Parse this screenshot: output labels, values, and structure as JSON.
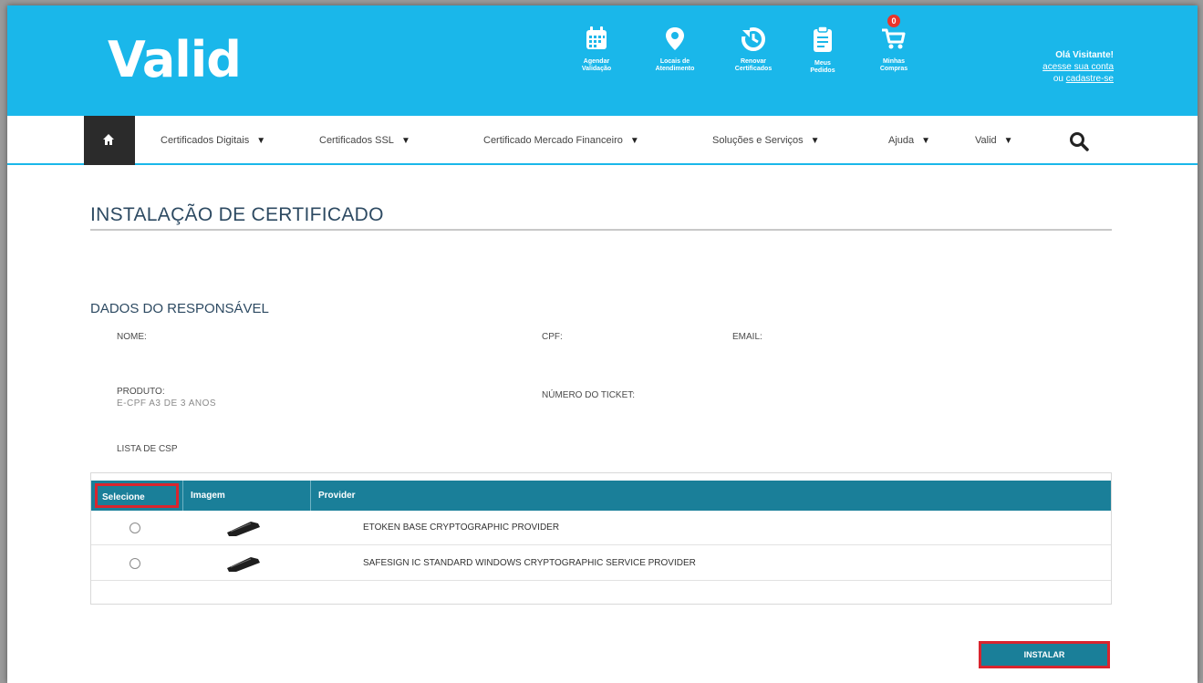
{
  "header": {
    "logo": "Valid",
    "icons": [
      {
        "label1": "Agendar",
        "label2": "Validação",
        "icon": "calendar-icon"
      },
      {
        "label1": "Locais de",
        "label2": "Atendimento",
        "icon": "location-pin-icon"
      },
      {
        "label1": "Renovar",
        "label2": "Certificados",
        "icon": "renew-clock-icon"
      },
      {
        "label1": "Meus",
        "label2": "Pedidos",
        "icon": "clipboard-icon"
      },
      {
        "label1": "Minhas",
        "label2": "Compras",
        "icon": "cart-icon"
      }
    ],
    "cart_count": "0",
    "greeting": "Olá Visitante!",
    "login_link": "acesse sua conta",
    "or_text": "ou",
    "register_link": "cadastre-se"
  },
  "nav": {
    "items": [
      "Certificados Digitais",
      "Certificados SSL",
      "Certificado Mercado Financeiro",
      "Soluções e Serviços",
      "Ajuda",
      "Valid"
    ],
    "caret": "▼"
  },
  "page": {
    "title": "INSTALAÇÃO DE  CERTIFICADO",
    "section_title": "DADOS DO RESPONSÁVEL",
    "labels": {
      "nome": "NOME:",
      "cpf": "CPF:",
      "email": "EMAIL:",
      "produto": "PRODUTO:",
      "ticket": "NÚMERO DO TICKET:",
      "lista_csp": "LISTA DE CSP"
    },
    "produto_value": "E-CPF A3 DE 3 ANOS"
  },
  "table": {
    "headers": {
      "selecione": "Selecione",
      "imagem": "Imagem",
      "provider": "Provider"
    },
    "rows": [
      {
        "provider": "ETOKEN BASE CRYPTOGRAPHIC PROVIDER"
      },
      {
        "provider": "SAFESIGN IC STANDARD WINDOWS CRYPTOGRAPHIC SERVICE PROVIDER"
      }
    ]
  },
  "actions": {
    "install_label": "INSTALAR"
  },
  "colors": {
    "brand": "#1ab7ea",
    "table_header": "#1a7f99",
    "highlight": "#d9252e"
  }
}
